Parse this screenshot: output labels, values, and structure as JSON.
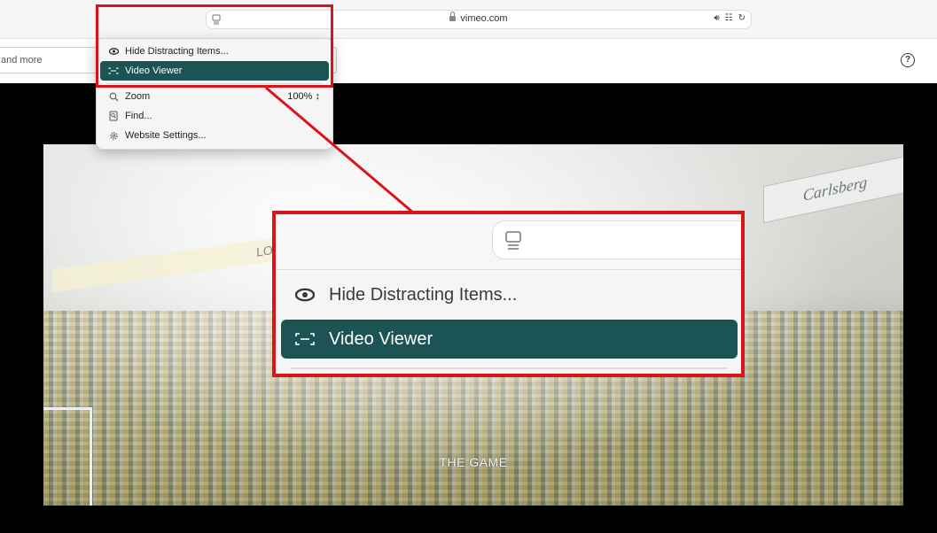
{
  "browser": {
    "url": "vimeo.com",
    "reader_icon": "reader-view-icon",
    "lock_icon": "lock-icon",
    "audio_icon": "speaker-icon",
    "translate_icon": "translate-icon",
    "reload_icon": "reload-icon"
  },
  "header": {
    "search_text": "and more",
    "help_label": "?"
  },
  "page_menu": {
    "items": [
      {
        "label": "Hide Distracting Items...",
        "icon": "eye-icon"
      },
      {
        "label": "Video Viewer",
        "icon": "video-viewer-icon",
        "selected": true
      },
      {
        "label": "Zoom",
        "icon": "zoom-icon",
        "value": "100%"
      },
      {
        "label": "Find...",
        "icon": "find-icon"
      },
      {
        "label": "Website Settings...",
        "icon": "gear-icon"
      }
    ]
  },
  "video": {
    "caption": "THE GAME",
    "banner_right": "Carlsberg",
    "banner_left": "LONDON"
  },
  "colors": {
    "highlight": "#d9141a",
    "selected_bg": "#1c5456"
  }
}
